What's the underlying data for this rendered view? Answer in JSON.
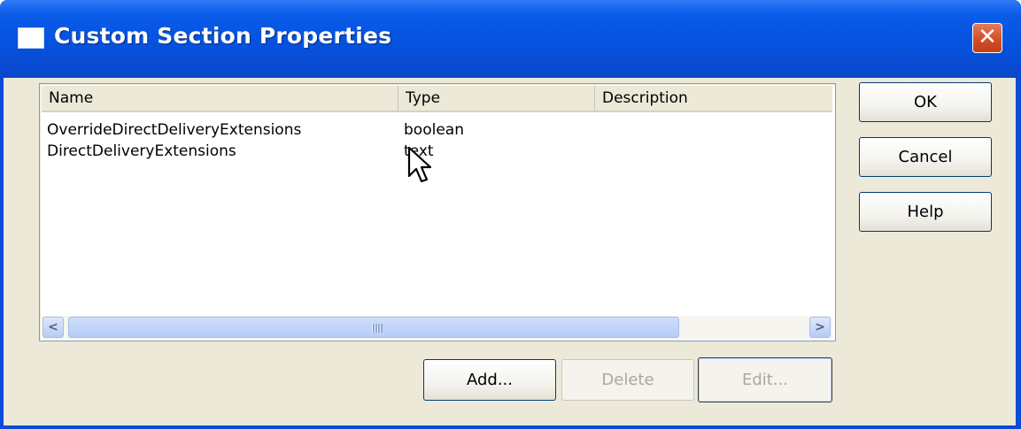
{
  "window": {
    "title": "Custom Section Properties",
    "close_glyph": "✕"
  },
  "list": {
    "columns": [
      "Name",
      "Type",
      "Description"
    ],
    "rows": [
      {
        "name": "OverrideDirectDeliveryExtensions",
        "type": "boolean",
        "description": ""
      },
      {
        "name": "DirectDeliveryExtensions",
        "type": "text",
        "description": ""
      }
    ],
    "scroll_left_glyph": "<",
    "scroll_right_glyph": ">"
  },
  "buttons": {
    "ok": "OK",
    "cancel": "Cancel",
    "help": "Help",
    "add": "Add...",
    "delete": "Delete",
    "edit": "Edit..."
  },
  "colors": {
    "titlebar": "#0552e0",
    "face": "#ece9d8",
    "close": "#d24e26"
  },
  "icons": [
    "window-icon",
    "close-icon",
    "scroll-left-icon",
    "scroll-right-icon",
    "mouse-pointer-icon"
  ]
}
